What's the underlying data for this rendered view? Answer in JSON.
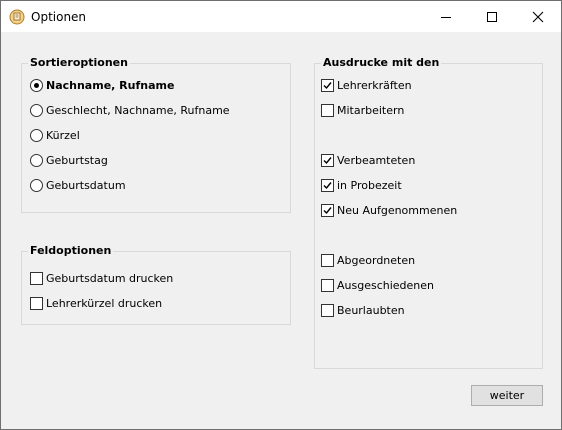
{
  "window": {
    "title": "Optionen"
  },
  "sort": {
    "title": "Sortieroptionen",
    "options": [
      {
        "label": "Nachname, Rufname",
        "selected": true
      },
      {
        "label": "Geschlecht, Nachname, Rufname",
        "selected": false
      },
      {
        "label": "Kürzel",
        "selected": false
      },
      {
        "label": "Geburtstag",
        "selected": false
      },
      {
        "label": "Geburtsdatum",
        "selected": false
      }
    ]
  },
  "fields": {
    "title": "Feldoptionen",
    "options": [
      {
        "label": "Geburtsdatum drucken",
        "checked": false
      },
      {
        "label": "Lehrerkürzel drucken",
        "checked": false
      }
    ]
  },
  "prints": {
    "title": "Ausdrucke mit den",
    "options": [
      {
        "label": "Lehrerkräften",
        "checked": true
      },
      {
        "label": "Mitarbeitern",
        "checked": false
      },
      {
        "label": "Verbeamteten",
        "checked": true
      },
      {
        "label": "in Probezeit",
        "checked": true
      },
      {
        "label": "Neu Aufgenommenen",
        "checked": true
      },
      {
        "label": "Abgeordneten",
        "checked": false
      },
      {
        "label": "Ausgeschiedenen",
        "checked": false
      },
      {
        "label": "Beurlaubten",
        "checked": false
      }
    ]
  },
  "buttons": {
    "next": "weiter"
  }
}
